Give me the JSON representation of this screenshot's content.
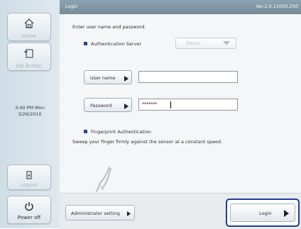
{
  "sidebar": {
    "home_label": "Home",
    "job_button_label": "Job Button",
    "clock_time": "3:40 PM Mon",
    "clock_date": "3/29/2010",
    "logout_label": "Logout",
    "power_label": "Power off",
    "icons": [
      "home-icon",
      "job-button-icon",
      "logout-icon",
      "power-icon"
    ]
  },
  "titlebar": {
    "title": "Login",
    "version": "Ver.2.0.11003.250"
  },
  "main": {
    "instruction": "Enter user name and password.",
    "auth_server_label": "Authentication Server",
    "auth_server_value": "Device",
    "username_label": "User name",
    "username_value": "",
    "password_label": "Password",
    "password_value": "*******",
    "fingerprint_label": "Fingerprint Authentication",
    "fingerprint_hint": "Sweep your finger firmly against the sensor at a constant speed."
  },
  "footer": {
    "admin_label": "Administrator setting",
    "login_label": "Login"
  },
  "colors": {
    "accent": "#26479b",
    "highlight_border": "#1a3f9e",
    "titlebar": "#7f95a3"
  }
}
